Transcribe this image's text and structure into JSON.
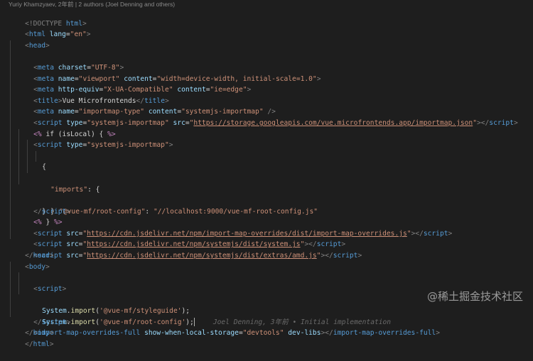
{
  "blame_header": "Yuriy Khamzyaev, 2年前 | 2 authors (Joel Denning and others)",
  "inline_blame": "Joel Denning, 3年前 • Initial implementation",
  "watermark": "@稀土掘金技术社区",
  "code": {
    "l1": [
      "<!DOCTYPE ",
      "html",
      ">"
    ],
    "l2": [
      "<",
      "html",
      " ",
      "lang",
      "=",
      "\"en\"",
      ">"
    ],
    "l3": [
      "<",
      "head",
      ">"
    ],
    "l4": [
      "<",
      "meta",
      " ",
      "charset",
      "=",
      "\"UTF-8\"",
      ">"
    ],
    "l5": [
      "<",
      "meta",
      " ",
      "name",
      "=",
      "\"viewport\"",
      " ",
      "content",
      "=",
      "\"width=device-width, initial-scale=1.0\"",
      ">"
    ],
    "l6": [
      "<",
      "meta",
      " ",
      "http-equiv",
      "=",
      "\"X-UA-Compatible\"",
      " ",
      "content",
      "=",
      "\"ie=edge\"",
      ">"
    ],
    "l7": [
      "<",
      "title",
      ">",
      "Vue Microfrontends",
      "</",
      "title",
      ">"
    ],
    "l8": [
      "<",
      "meta",
      " ",
      "name",
      "=",
      "\"importmap-type\"",
      " ",
      "content",
      "=",
      "\"systemjs-importmap\"",
      " />"
    ],
    "l9": [
      "<",
      "script",
      " ",
      "type",
      "=",
      "\"systemjs-importmap\"",
      " ",
      "src",
      "=",
      "\"",
      "https://storage.googleapis.com/vue.microfrontends.app/importmap.json",
      "\"",
      "></",
      "script",
      ">"
    ],
    "l10": [
      "<%",
      " if (isLocal) { ",
      "%>"
    ],
    "l11": [
      "<",
      "script",
      " ",
      "type",
      "=",
      "\"systemjs-importmap\"",
      ">"
    ],
    "l12": [
      "{"
    ],
    "l13": [
      "\"imports\"",
      ": {"
    ],
    "l14": [
      "\"@vue-mf/root-config\"",
      ": ",
      "\"//localhost:9000/vue-mf-root-config.js\""
    ],
    "l15": [
      "}"
    ],
    "l16": [
      "}"
    ],
    "l17": [
      "</",
      "script",
      ">"
    ],
    "l18": [
      "<%",
      " } ",
      "%>"
    ],
    "l19": [
      "<",
      "script",
      " ",
      "src",
      "=",
      "\"",
      "https://cdn.jsdelivr.net/npm/import-map-overrides/dist/import-map-overrides.js",
      "\"",
      "></",
      "script",
      ">"
    ],
    "l20": [
      "<",
      "script",
      " ",
      "src",
      "=",
      "\"",
      "https://cdn.jsdelivr.net/npm/systemjs/dist/system.js",
      "\"",
      "></",
      "script",
      ">"
    ],
    "l21": [
      "<",
      "script",
      " ",
      "src",
      "=",
      "\"",
      "https://cdn.jsdelivr.net/npm/systemjs/dist/extras/amd.js",
      "\"",
      "></",
      "script",
      ">"
    ],
    "l22": [
      "</",
      "head",
      ">"
    ],
    "l23": [
      "<",
      "body",
      ">"
    ],
    "l24": [
      "<",
      "script",
      ">"
    ],
    "l25": [
      "System",
      ".",
      "import",
      "(",
      "'@vue-mf/styleguide'",
      ");"
    ],
    "l26": [
      "System",
      ".",
      "import",
      "(",
      "'@vue-mf/root-config'",
      ");"
    ],
    "l27": [
      "</",
      "script",
      ">"
    ],
    "l28": [
      "<",
      "import-map-overrides-full",
      " ",
      "show-when-local-storage",
      "=",
      "\"devtools\"",
      " ",
      "dev-libs",
      "></",
      "import-map-overrides-full",
      ">"
    ],
    "l29": [
      "</",
      "body",
      ">"
    ],
    "l30": [
      "</",
      "html",
      ">"
    ]
  }
}
